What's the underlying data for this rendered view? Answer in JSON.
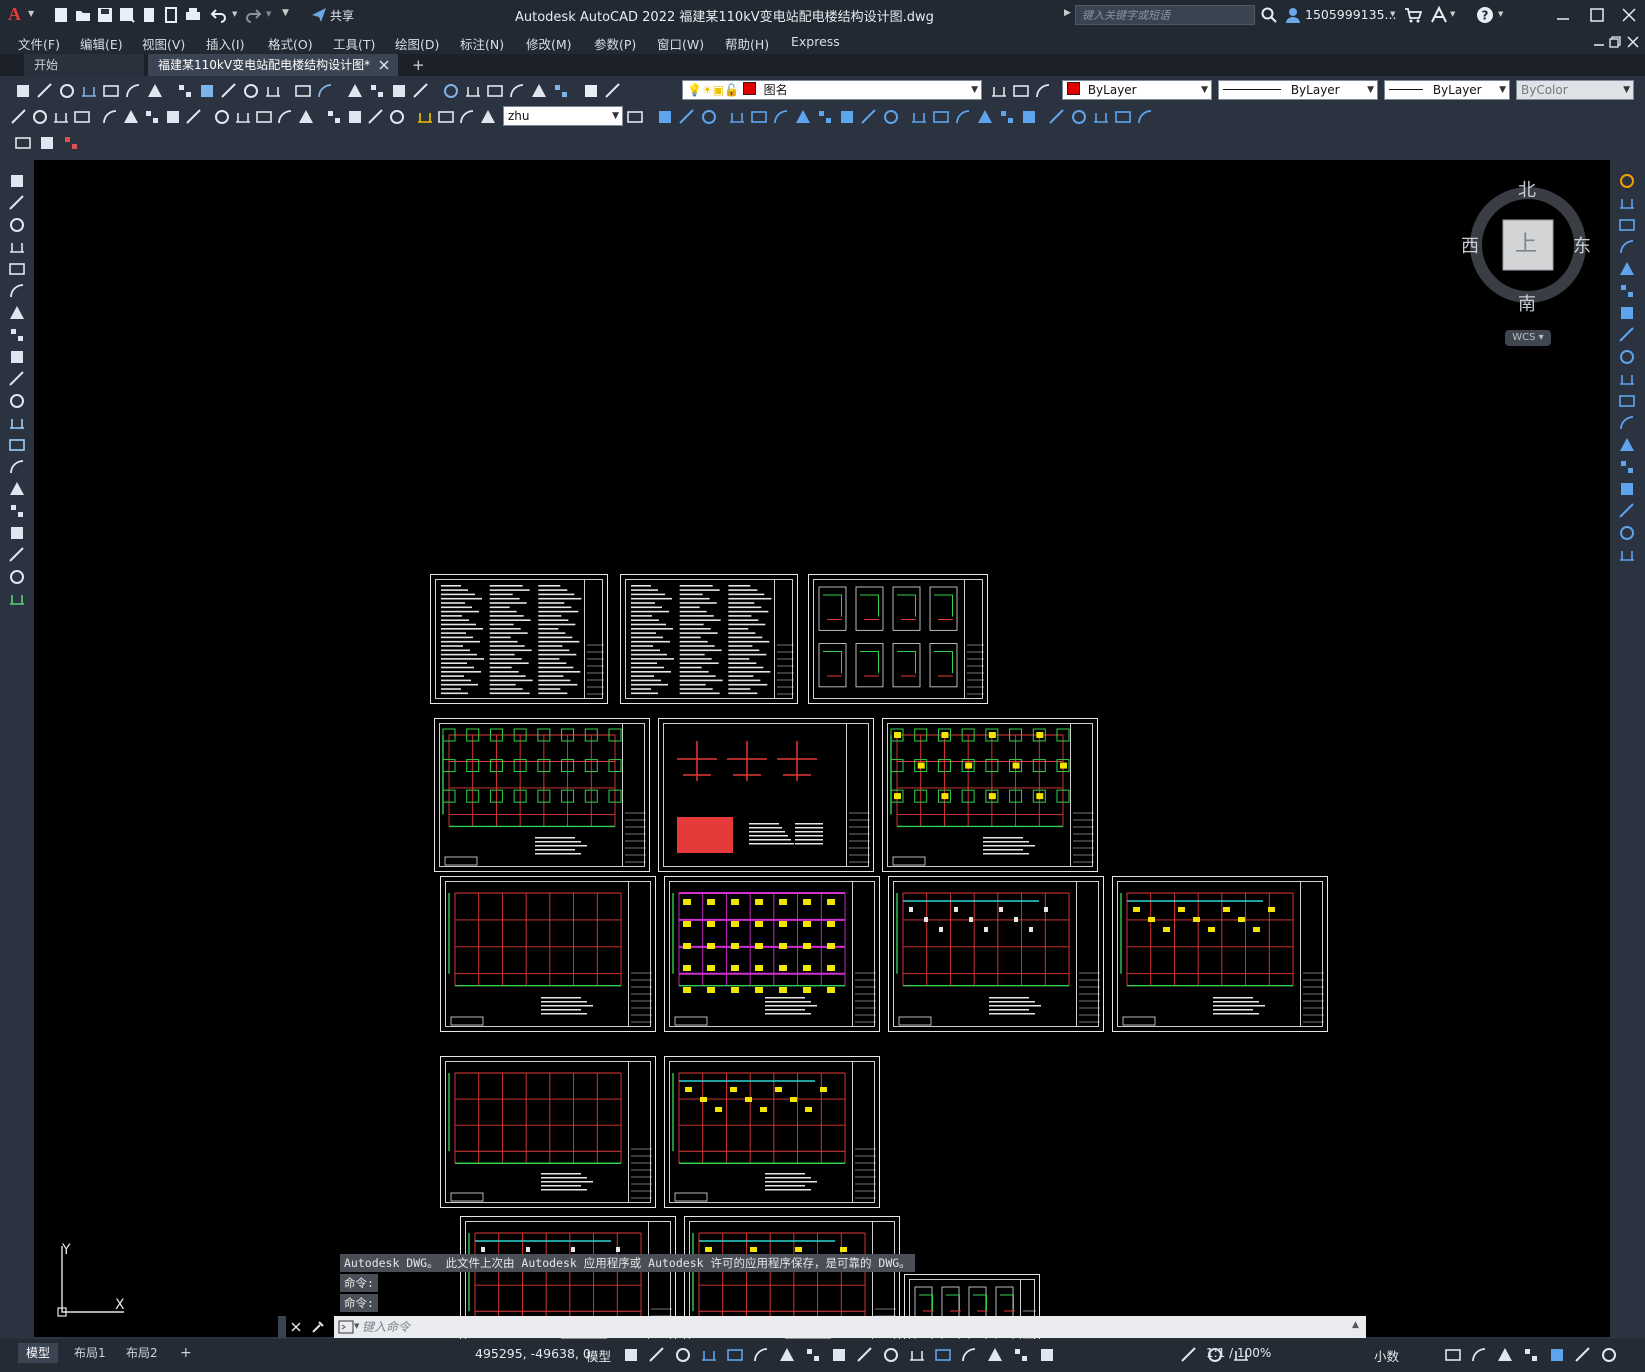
{
  "window": {
    "title": "Autodesk AutoCAD 2022    福建某110kV变电站配电楼结构设计图.dwg",
    "share_label": "共享",
    "search_placeholder": "键入关键字或短语",
    "user_name": "1505999135...",
    "app_letter": "A"
  },
  "menu": {
    "items": [
      "文件(F)",
      "编辑(E)",
      "视图(V)",
      "插入(I)",
      "格式(O)",
      "工具(T)",
      "绘图(D)",
      "标注(N)",
      "修改(M)",
      "参数(P)",
      "窗口(W)",
      "帮助(H)",
      "Express"
    ]
  },
  "tabs": {
    "start": "开始",
    "active": "福建某110kV变电站配电楼结构设计图*",
    "add": "+"
  },
  "toolbar": {
    "layer_combo": "图名",
    "color_combo": "ByLayer",
    "linetype_combo": "ByLayer",
    "lineweight_combo": "ByLayer",
    "plotstyle_combo": "ByColor",
    "dimstyle_combo": "zhu"
  },
  "viewcube": {
    "north": "北",
    "south": "南",
    "east": "东",
    "west": "西",
    "face": "上",
    "wcs": "WCS"
  },
  "ucs": {
    "x": "X",
    "y": "Y"
  },
  "command": {
    "history": [
      "Autodesk DWG。  此文件上次由 Autodesk 应用程序或 Autodesk 许可的应用程序保存，是可靠的 DWG。",
      "命令:",
      "命令:"
    ],
    "placeholder": "键入命令"
  },
  "layouts": {
    "model": "模型",
    "layout1": "布局1",
    "layout2": "布局2",
    "add": "+"
  },
  "status": {
    "coords": "495295, -49638, 0",
    "space": "模型",
    "scale": "1:1 / 100%",
    "units": "小数"
  },
  "colors": {
    "background": "#000000",
    "ui": "#2b3340",
    "accent": "#3a8fd8"
  }
}
